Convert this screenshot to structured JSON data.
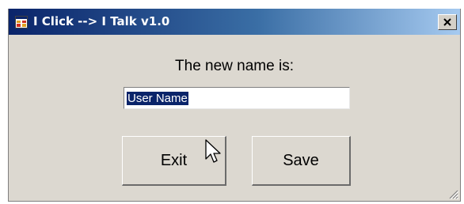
{
  "window": {
    "title": "I Click --> I Talk v1.0",
    "icons": {
      "app": "app-window-icon",
      "close": "close-icon",
      "cursor": "mouse-pointer-icon",
      "grip": "resize-grip-icon"
    },
    "colors": {
      "titlebar_start": "#0a246a",
      "titlebar_end": "#a6caf0",
      "body": "#dcd8d0",
      "selection": "#0a246a"
    }
  },
  "form": {
    "prompt": "The new name is:",
    "name_value": "User Name"
  },
  "buttons": {
    "exit_label": "Exit",
    "save_label": "Save"
  }
}
